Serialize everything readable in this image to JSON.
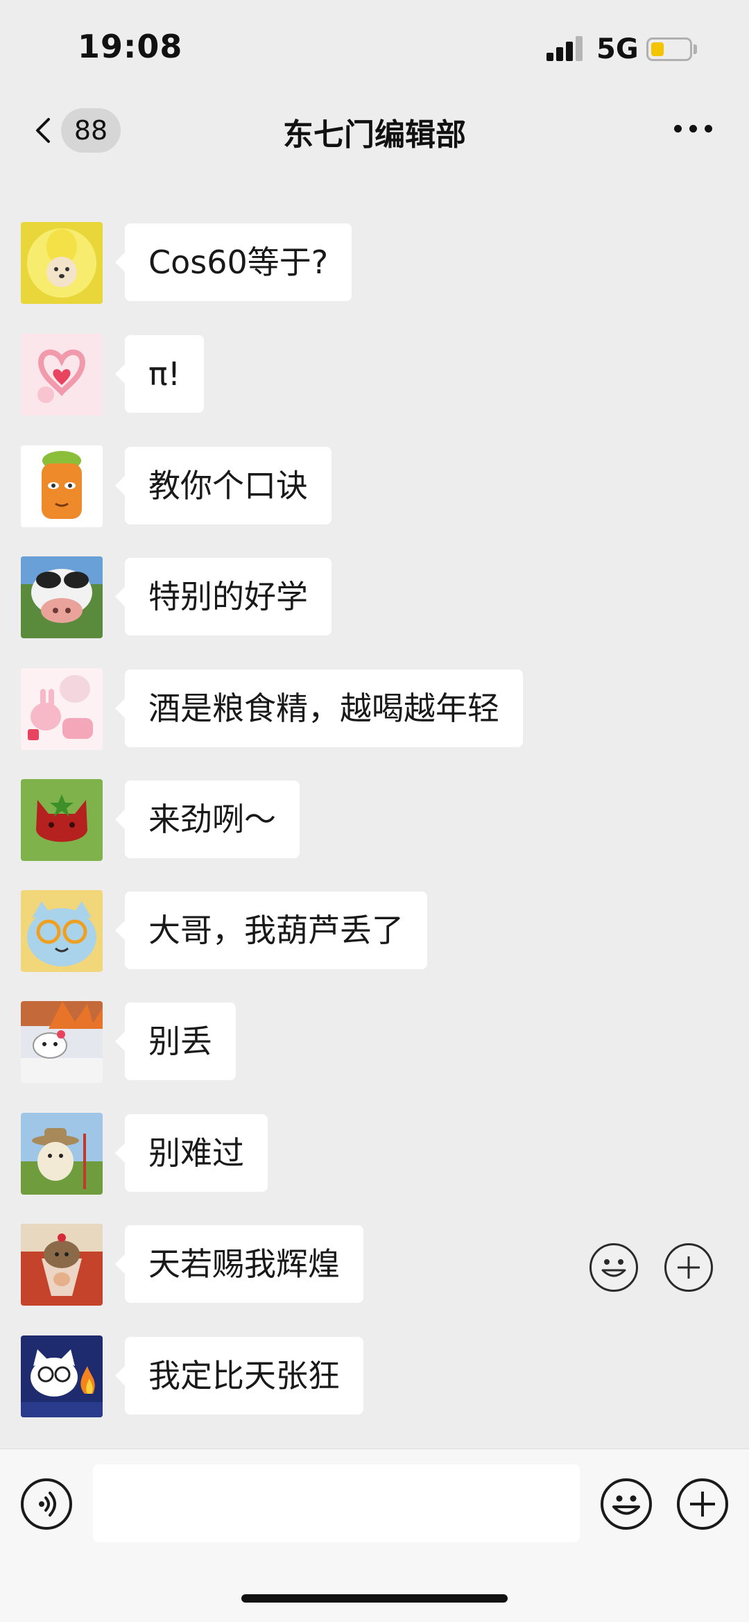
{
  "status_bar": {
    "time": "19:08",
    "network": "5G",
    "battery_level": 0.35
  },
  "nav": {
    "unread_count": "88",
    "title": "东七门编辑部"
  },
  "messages": [
    {
      "text": "Cos60等于?",
      "avatar": "yellow-toy-avatar-icon"
    },
    {
      "text": "π!",
      "avatar": "pink-rabbit-heart-avatar-icon"
    },
    {
      "text": "教你个口诀",
      "avatar": "carrot-face-avatar-icon"
    },
    {
      "text": "特别的好学",
      "avatar": "cow-avatar-icon"
    },
    {
      "text": "酒是粮食精，越喝越年轻",
      "avatar": "pink-rabbit-avatar-icon"
    },
    {
      "text": "来劲咧～",
      "avatar": "strawberry-cat-avatar-icon"
    },
    {
      "text": "大哥，我葫芦丢了",
      "avatar": "blue-cat-glasses-avatar-icon"
    },
    {
      "text": "别丢",
      "avatar": "hello-kitty-fire-avatar-icon"
    },
    {
      "text": "别难过",
      "avatar": "cowboy-dog-avatar-icon"
    },
    {
      "text": "天若赐我辉煌",
      "avatar": "hedgehog-sundae-avatar-icon"
    },
    {
      "text": "我定比天张狂",
      "avatar": "cartoon-cat-fire-avatar-icon"
    }
  ],
  "input": {
    "placeholder": ""
  },
  "colors": {
    "background": "#ededed",
    "bubble": "#ffffff",
    "battery": "#f5c400"
  }
}
